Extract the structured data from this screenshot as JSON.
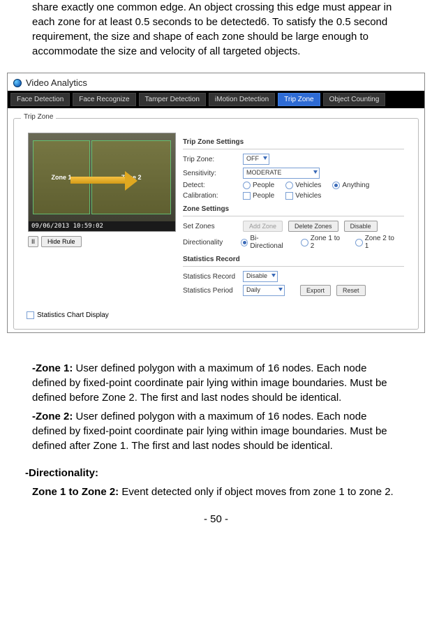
{
  "intro": "share exactly one common edge. An object crossing this edge must appear in each zone for at least 0.5 seconds to be detected6. To satisfy the 0.5 second requirement, the size and shape of each zone should be large enough to accommodate the size and velocity of all targeted objects.",
  "panel": {
    "title": "Video Analytics",
    "tabs": [
      "Face Detection",
      "Face Recognize",
      "Tamper Detection",
      "iMotion Detection",
      "Trip Zone",
      "Object Counting"
    ],
    "active_tab_index": 4,
    "fieldset_legend": "Trip Zone",
    "video": {
      "zone1_label": "Zone 1",
      "zone2_label": "Zone 2",
      "timestamp": "09/06/2013   10:59:02",
      "pause_btn": "II",
      "hide_rule_btn": "Hide Rule"
    },
    "settings": {
      "tz_title": "Trip Zone Settings",
      "trip_zone_lbl": "Trip Zone:",
      "trip_zone_val": "OFF",
      "sensitivity_lbl": "Sensitivity:",
      "sensitivity_val": "MODERATE",
      "detect_lbl": "Detect:",
      "detect_people": "People",
      "detect_vehicles": "Vehicles",
      "detect_anything": "Anything",
      "calibration_lbl": "Calibration:",
      "cal_people": "People",
      "cal_vehicles": "Vehicles",
      "zs_title": "Zone Settings",
      "set_zones_lbl": "Set Zones",
      "add_zone_btn": "Add Zone",
      "delete_zones_btn": "Delete Zones",
      "disable_btn": "Disable",
      "directionality_lbl": "Directionality",
      "dir_bi": "Bi-Directional",
      "dir_12": "Zone 1 to 2",
      "dir_21": "Zone 2 to 1",
      "sr_title": "Statistics Record",
      "stats_record_lbl": "Statistics Record",
      "stats_record_val": "Disable",
      "stats_period_lbl": "Statistics Period",
      "stats_period_val": "Daily",
      "export_btn": "Export",
      "reset_btn": "Reset"
    },
    "stats_chart_display": "Statistics Chart Display"
  },
  "desc": {
    "zone1_h": "-Zone 1: ",
    "zone1_t": "User defined polygon with a maximum of 16 nodes. Each node defined by fixed-point coordinate pair lying within image boundaries. Must be defined before Zone 2. The first and last nodes should be identical.",
    "zone2_h": "-Zone 2: ",
    "zone2_t": "User defined polygon with a maximum of 16 nodes. Each node defined by fixed-point coordinate pair lying within image boundaries. Must be defined after Zone 1. The first and last nodes should be identical.",
    "dir_h": "-Directionality:",
    "dir_z12_h": "Zone 1 to Zone 2: ",
    "dir_z12_t": "Event detected only if object moves from zone 1 to zone 2."
  },
  "page_number": "- 50 -"
}
